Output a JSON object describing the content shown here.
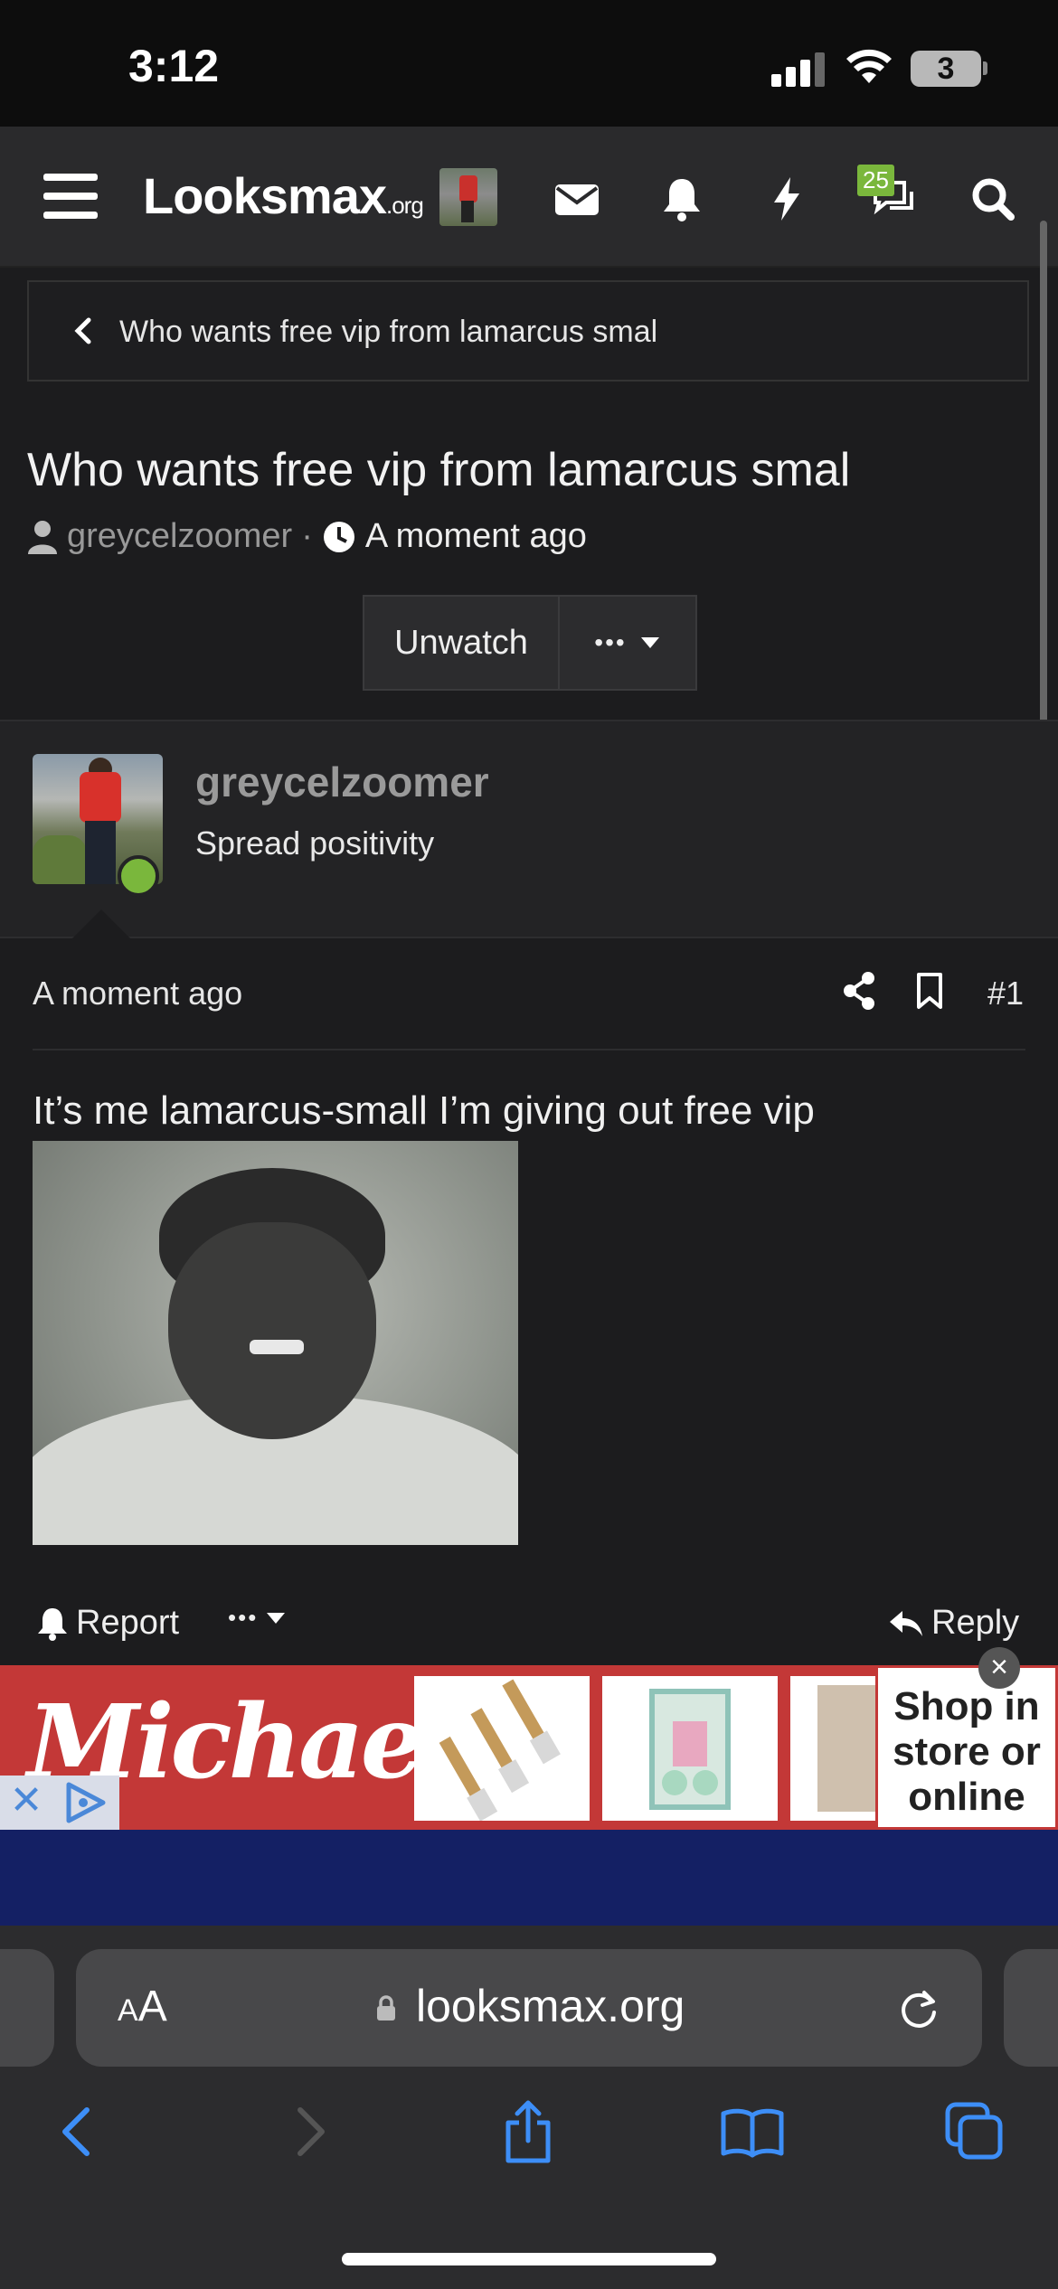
{
  "status_bar": {
    "time": "3:12",
    "battery": "3"
  },
  "header": {
    "logo_main": "Looksmax",
    "logo_suffix": ".org",
    "notification_badge": "25",
    "icons": [
      "menu-icon",
      "avatar",
      "mail-icon",
      "bell-icon",
      "bolt-icon",
      "chat-icon",
      "search-icon"
    ]
  },
  "breadcrumb": {
    "label": "Who wants free vip from lamarcus smal"
  },
  "thread": {
    "title": "Who wants free vip from lamarcus smal",
    "author": "greycelzoomer",
    "separator": "·",
    "time": "A moment ago",
    "unwatch_label": "Unwatch",
    "more_label": "•••"
  },
  "author_block": {
    "name": "greycelzoomer",
    "user_title": "Spread positivity",
    "status_color": "#7ab73c"
  },
  "post": {
    "time": "A moment ago",
    "number": "#1",
    "text": "It’s me lamarcus-small I’m giving out free vip",
    "report_label": "Report",
    "more_label": "•••",
    "reply_label": "Reply"
  },
  "ad": {
    "brand": "Michaels",
    "cta": [
      "Shop in",
      "store or",
      "online"
    ],
    "close": "×",
    "brand_color": "#c33837"
  },
  "browser": {
    "aa_small": "A",
    "aa_large": "A",
    "url": "looksmax.org"
  }
}
